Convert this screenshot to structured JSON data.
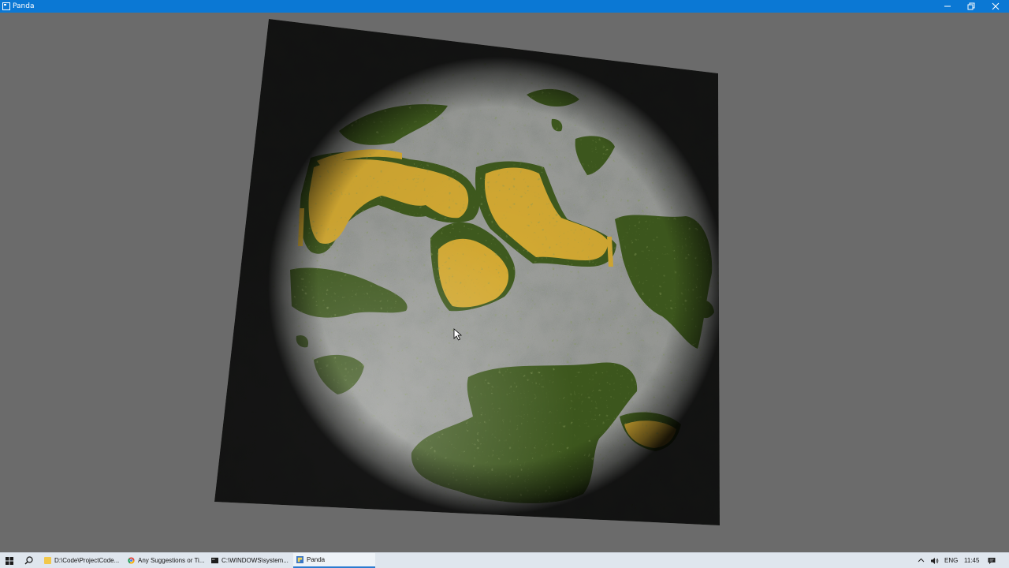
{
  "window": {
    "title": "Panda",
    "controls": [
      "minimize-icon",
      "restore-icon",
      "close-icon"
    ]
  },
  "taskbar": {
    "start_icon": "windows-icon",
    "search_icon": "search-icon",
    "tasks": [
      {
        "label": "D:\\Code\\ProjectCode...",
        "icon": "folder-icon",
        "color": "#f2c84b"
      },
      {
        "label": "Any Suggestions or Ti...",
        "icon": "chrome-icon",
        "color": "#db4437"
      },
      {
        "label": "C:\\WINDOWS\\system...",
        "icon": "console-icon",
        "color": "#1e1e1e"
      },
      {
        "label": "Panda",
        "icon": "panda-icon",
        "color": "#3a76c4",
        "active": true
      }
    ],
    "tray": {
      "chevron_icon": "chevron-up-icon",
      "volume_icon": "volume-icon",
      "language": "ENG",
      "time": "11:45",
      "notification_icon": "notification-icon"
    }
  },
  "colors": {
    "titlebar": "#0b78d4",
    "background": "#6b6b6b",
    "map_rock": "#9a9c98",
    "map_green": "#3f5a1e",
    "map_gold": "#d4aa33"
  }
}
